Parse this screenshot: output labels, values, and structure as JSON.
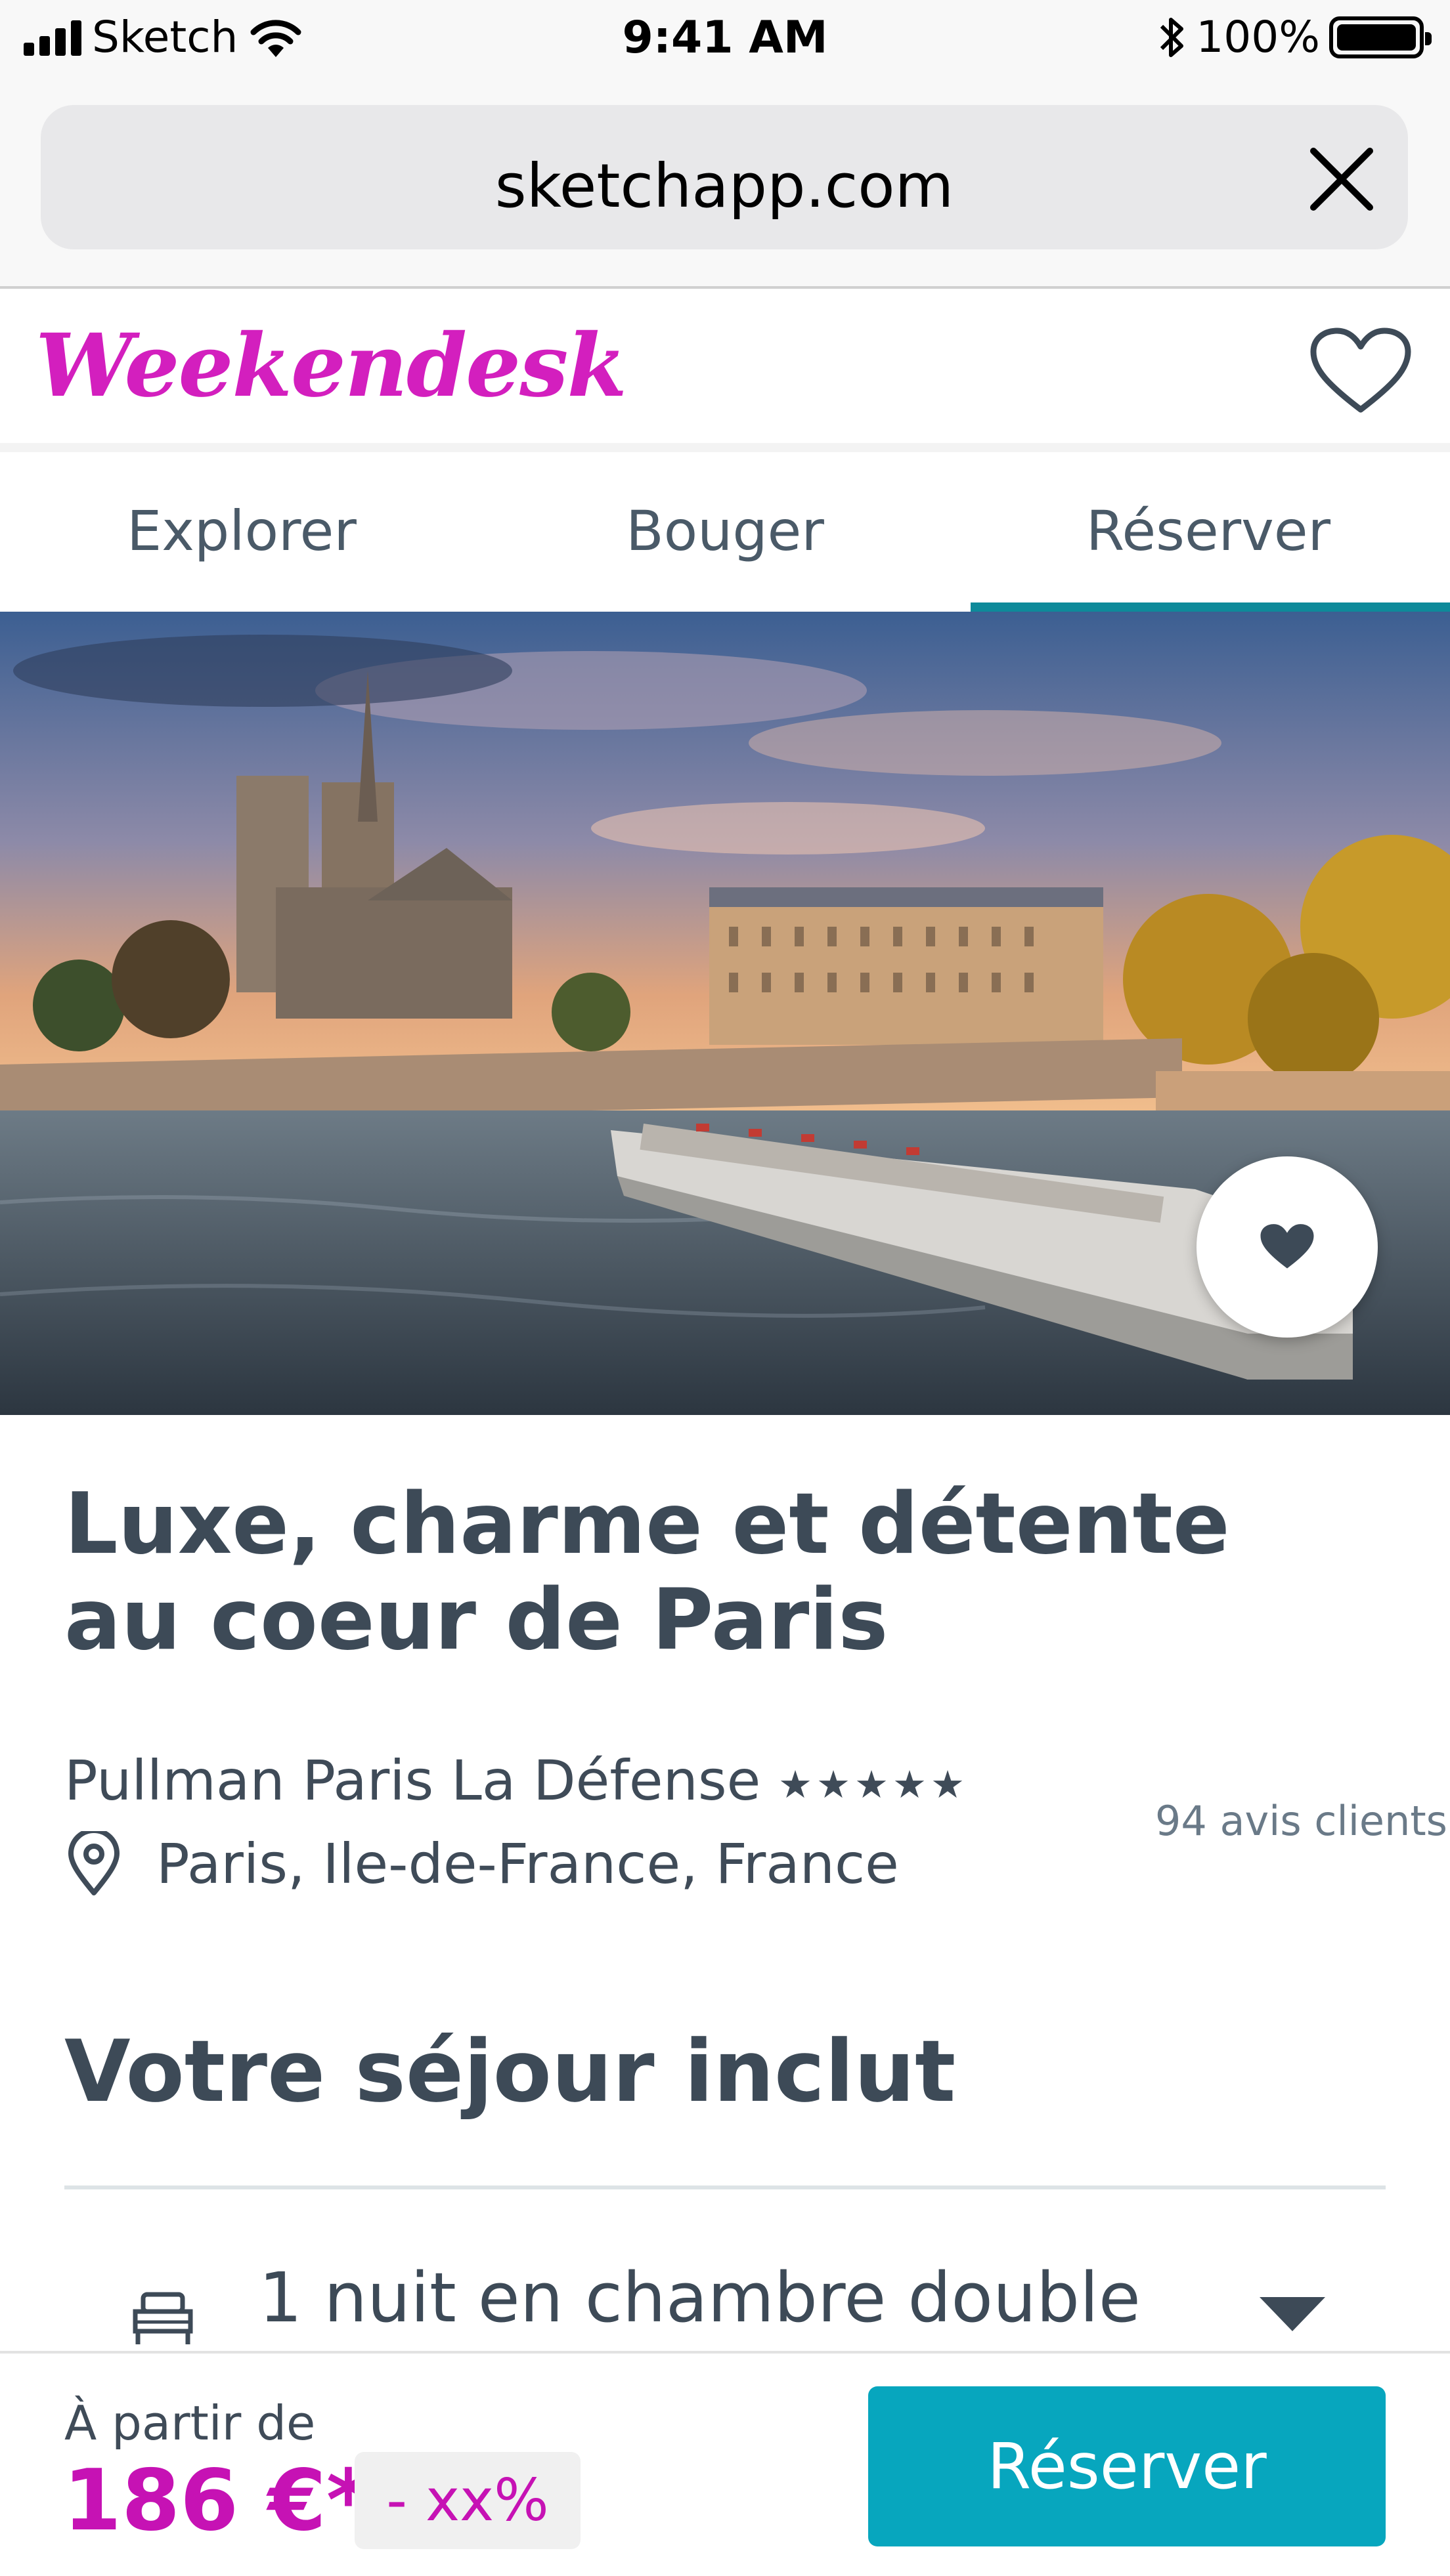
{
  "status_bar": {
    "carrier": "Sketch",
    "time": "9:41 AM",
    "battery_percent": "100%",
    "icons": [
      "signal-icon",
      "wifi-icon",
      "bluetooth-icon",
      "battery-icon"
    ]
  },
  "browser": {
    "url": "sketchapp.com",
    "load_progress": 0.16,
    "close_icon": "close-icon",
    "accent_color": "#1c7ff0"
  },
  "site": {
    "logo_text": "Weekendesk",
    "brand_color": "#d31fbe",
    "header_icon": "heart-outline-icon"
  },
  "tabs": [
    {
      "label": "Explorer",
      "active": false
    },
    {
      "label": "Bouger",
      "active": false
    },
    {
      "label": "Réserver",
      "active": true
    }
  ],
  "hero": {
    "favorite_icon": "heart-filled-icon"
  },
  "listing": {
    "title": "Luxe, charme et détente au coeur de Paris",
    "hotel_name": "Pullman Paris La Défense",
    "stars": "★★★★★",
    "star_count": 5,
    "location": "Paris, Ile-de-France, France",
    "location_icon": "map-pin-icon",
    "reviews": "94 avis clients"
  },
  "includes": {
    "section_title": "Votre séjour inclut",
    "items": [
      {
        "label": "1 nuit en chambre double",
        "icon": "bed-icon",
        "expand_icon": "caret-down-icon"
      }
    ]
  },
  "booking": {
    "from_label": "À partir de",
    "price": "186 €*",
    "discount": "- xx%",
    "reserve_label": "Réserver",
    "button_color": "#07a6be",
    "price_color": "#c612b4"
  }
}
